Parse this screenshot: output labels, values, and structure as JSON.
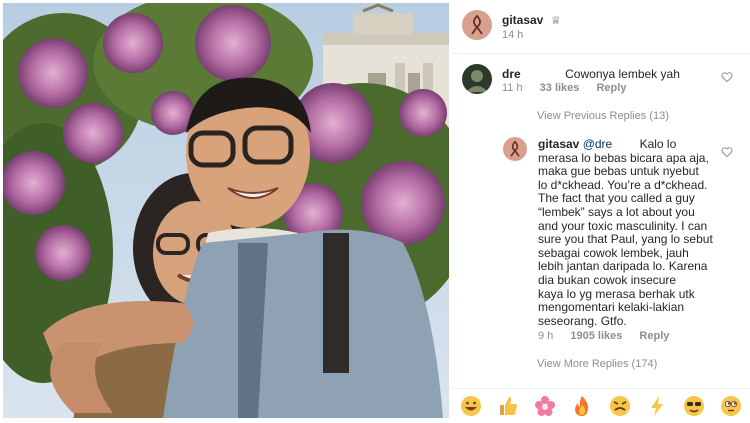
{
  "post": {
    "author": "gitasav",
    "author_badge": "♕",
    "time": "14 h"
  },
  "comment1": {
    "username": "dre",
    "text": "Cowonya lembek yah",
    "time": "11 h",
    "likes": "33 likes",
    "reply": "Reply"
  },
  "view_previous": "View Previous Replies (13)",
  "comment2": {
    "username": "gitasav",
    "mention": "@dre",
    "lines": [
      "Kalo lo",
      "merasa lo bebas bicara apa aja,",
      "maka gue bebas untuk nyebut",
      "lo d*ckhead. You’re a d*ckhead.",
      "The fact that you called a guy",
      "“lembek” says a lot about you",
      "and your toxic masculinity. I can",
      "sure you that Paul, yang lo sebut",
      "sebagai cowok lembek, jauh",
      "lebih jantan daripada lo. Karena",
      "dia bukan cowok insecure",
      "kaya lo yg merasa berhak utk",
      "mengomentari kelaki-lakian",
      "seseorang. Gtfo."
    ],
    "time": "9 h",
    "likes": "1905 likes",
    "reply": "Reply"
  },
  "view_more": "View More Replies (174)",
  "emoji_bar": [
    "grinning-face",
    "thumbs-up",
    "flower",
    "fire",
    "angry-face",
    "lightning",
    "sunglasses-face",
    "eyes-face"
  ],
  "colors": {
    "link_mention": "#003569",
    "meta_gray": "#8e8e8e",
    "text": "#262626"
  }
}
